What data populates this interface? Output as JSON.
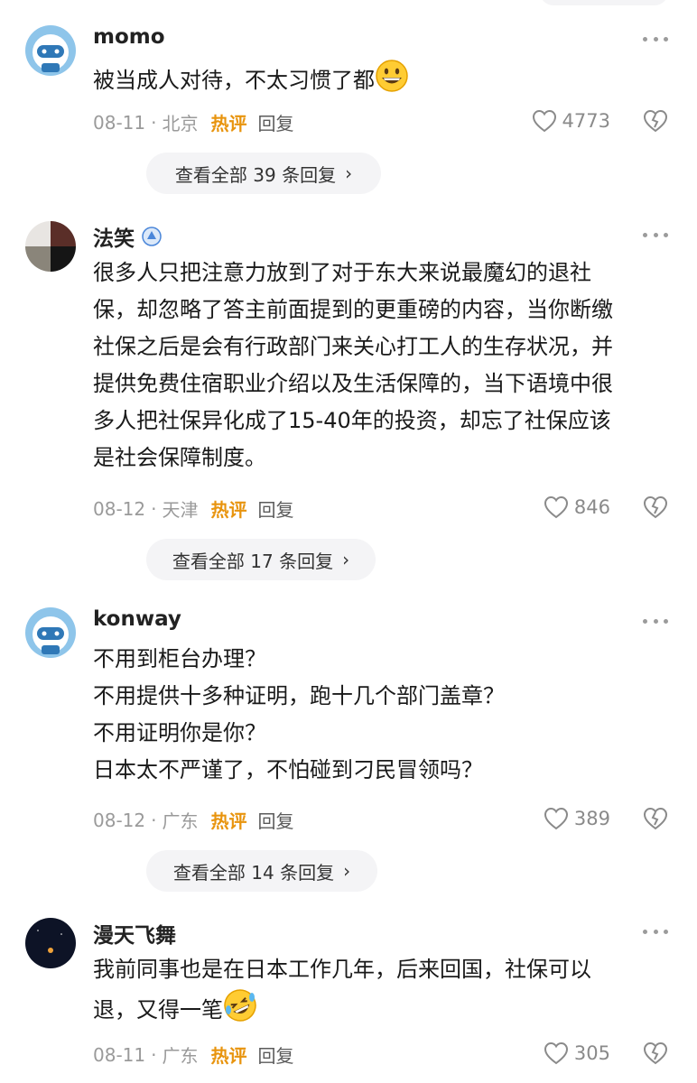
{
  "comments": [
    {
      "author": "momo",
      "text": "被当成人对待，不太习惯了都",
      "emoji": "grinning-face-emoji",
      "date": "08-11",
      "location": "北京",
      "hot": "热评",
      "reply": "回复",
      "likes": "4773",
      "view_all": "查看全部 39 条回复"
    },
    {
      "author": "法笑",
      "badge": "verified-badge-icon",
      "text": "很多人只把注意力放到了对于东大来说最魔幻的退社\n保，却忽略了答主前面提到的更重磅的内容，当你断缴\n社保之后是会有行政部门来关心打工人的生存状况，并\n提供免费住宿职业介绍以及生活保障的，当下语境中很\n多人把社保异化成了15-40年的投资，却忘了社保应该\n是社会保障制度。",
      "date": "08-12",
      "location": "天津",
      "hot": "热评",
      "reply": "回复",
      "likes": "846",
      "view_all": "查看全部 17 条回复"
    },
    {
      "author": "konway",
      "text": "不用到柜台办理？\n不用提供十多种证明，跑十几个部门盖章？\n不用证明你是你？\n日本太不严谨了，不怕碰到刁民冒领吗？",
      "date": "08-12",
      "location": "广东",
      "hot": "热评",
      "reply": "回复",
      "likes": "389",
      "view_all": "查看全部 14 条回复"
    },
    {
      "author": "漫天飞舞",
      "text": "我前同事也是在日本工作几年，后来回国，社保可以\n退，又得一笔",
      "emoji": "rolling-laughing-emoji",
      "date": "08-11",
      "location": "广东",
      "hot": "热评",
      "reply": "回复",
      "likes": "305"
    }
  ],
  "separator": "·",
  "colors": {
    "hot": "#e8940e",
    "meta": "#9a9a9a",
    "pill_bg": "#f4f4f6"
  }
}
